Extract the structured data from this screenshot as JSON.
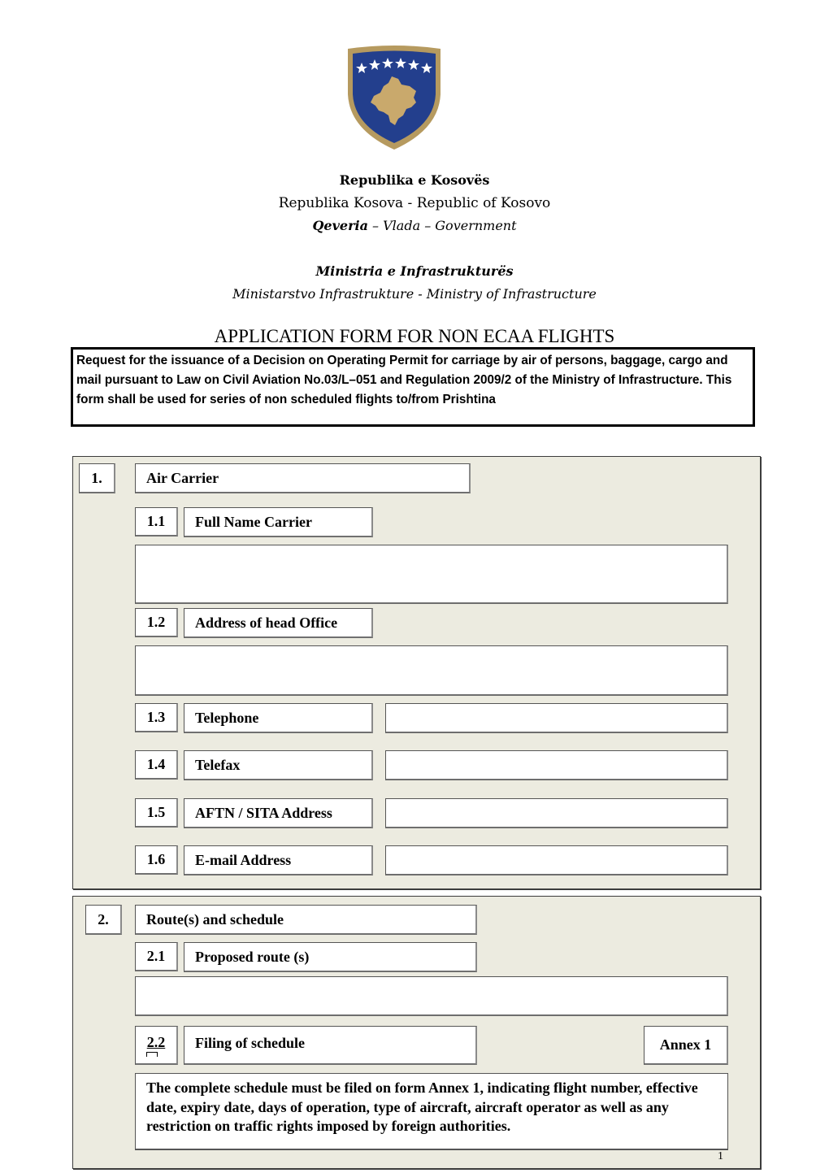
{
  "header": {
    "crest": {
      "name": "coat-of-arms-of-kosovo",
      "colors": {
        "field": "#233f8d",
        "border": "#b69a5f",
        "map": "#c9a96c",
        "stars": "#ffffff"
      },
      "star_count": 6
    },
    "line1": "Republika e Kosovës",
    "line2": "Republika Kosova - Republic of Kosovo",
    "line3_bold": "Qeveria",
    "line3_rest": " – Vlada – Government",
    "line4": "Ministria e Infrastrukturës",
    "line5": "Ministarstvo  Infrastrukture - Ministry of Infrastructure"
  },
  "form": {
    "title": "APPLICATION FORM FOR NON ECAA FLIGHTS",
    "intro": "Request for the issuance of a Decision on Operating Permit for carriage by air of  persons, baggage, cargo and mail pursuant to Law on Civil Aviation No.03/L–051 and Regulation 2009/2 of the Ministry of Infrastructure. This form shall be used for series of non scheduled flights to/from Prishtina"
  },
  "section1": {
    "number": "1.",
    "title": "Air Carrier",
    "items": [
      {
        "number": "1.1",
        "label": "Full Name Carrier",
        "value": ""
      },
      {
        "number": "1.2",
        "label": "Address of head Office",
        "value": ""
      },
      {
        "number": "1.3",
        "label": "Telephone",
        "value": ""
      },
      {
        "number": "1.4",
        "label": "Telefax",
        "value": ""
      },
      {
        "number": "1.5",
        "label": "AFTN / SITA Address",
        "value": ""
      },
      {
        "number": "1.6",
        "label": "E-mail Address",
        "value": ""
      }
    ]
  },
  "section2": {
    "number": "2.",
    "title": "Route(s) and schedule",
    "items": [
      {
        "number": "2.1",
        "label": "Proposed route (s)",
        "value": ""
      },
      {
        "number": "2.2",
        "label": "Filing of schedule",
        "annex": "Annex 1"
      }
    ],
    "note": "The complete schedule must be filed on form Annex 1, indicating flight number, effective date, expiry date, days of operation, type of aircraft, aircraft operator as well as any restriction on traffic rights imposed by foreign authorities."
  },
  "footer": {
    "page_number": "1"
  }
}
